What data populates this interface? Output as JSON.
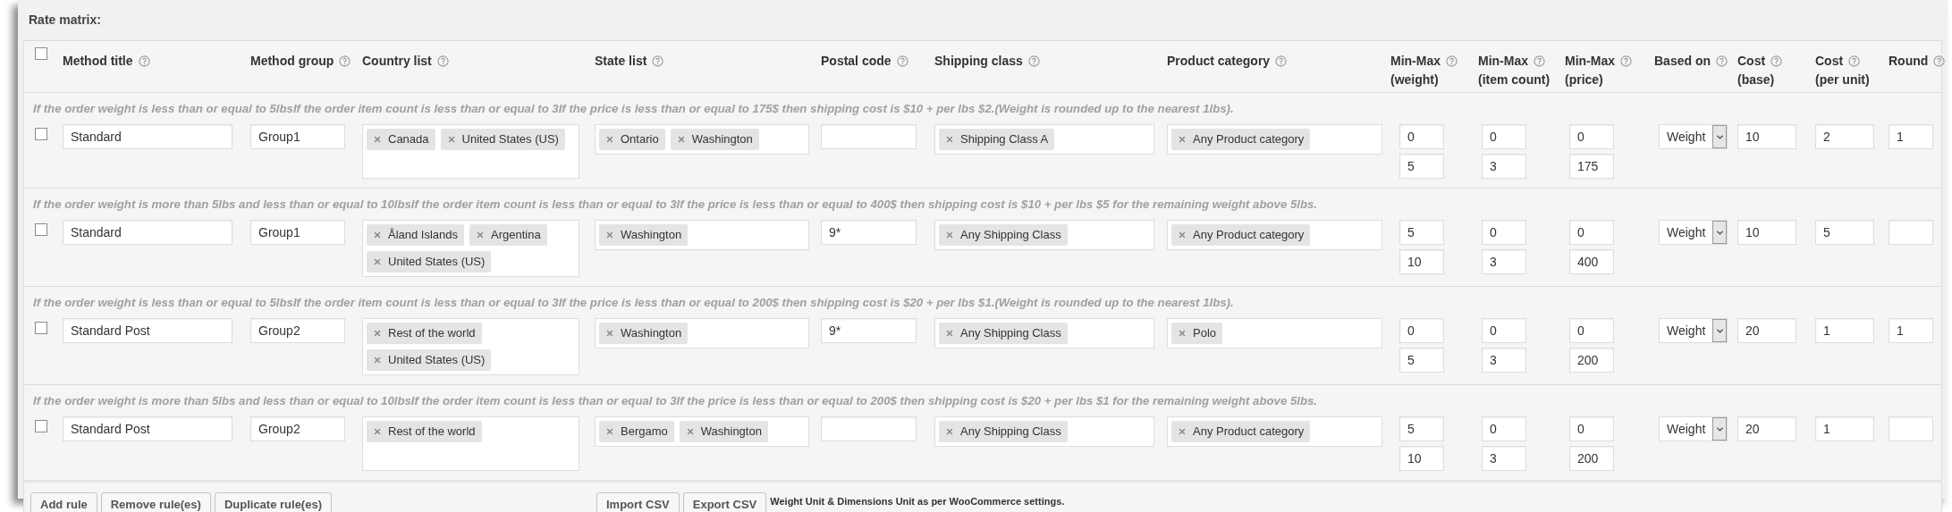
{
  "section_title": "Rate matrix:",
  "table": {
    "select_all": {
      "checked": false
    },
    "columns": [
      {
        "label": "Method title"
      },
      {
        "label": "Method group"
      },
      {
        "label": "Country list"
      },
      {
        "label": "State list"
      },
      {
        "label": "Postal code"
      },
      {
        "label": "Shipping class"
      },
      {
        "label": "Product category"
      },
      {
        "label": "Min-Max",
        "sublabel": "(weight)"
      },
      {
        "label": "Min-Max",
        "sublabel": "(item count)"
      },
      {
        "label": "Min-Max",
        "sublabel": "(price)"
      },
      {
        "label": "Based on"
      },
      {
        "label": "Cost",
        "sublabel": "(base)"
      },
      {
        "label": "Cost",
        "sublabel": "(per unit)"
      },
      {
        "label": "Round"
      }
    ],
    "rows": [
      {
        "description": "If the order weight is less than or equal to 5lbsIf the order item count is less than or equal to 3If the price is less than or equal to 175$ then shipping cost is $10 + per lbs $2.(Weight is rounded up to the nearest 1lbs).",
        "checked": false,
        "method_title": "Standard",
        "method_group": "Group1",
        "countries": [
          "Canada",
          "United States (US)"
        ],
        "states": [
          "Ontario",
          "Washington"
        ],
        "shipping_classes": [
          "Shipping Class A"
        ],
        "product_categories": [
          "Any Product category"
        ],
        "weight": {
          "min": "0",
          "max": "5"
        },
        "item_count": {
          "min": "0",
          "max": "3"
        },
        "price": {
          "min": "0",
          "max": "175"
        },
        "based_on": "Weight",
        "cost_base": "10",
        "cost_per_unit": "2",
        "round": "1"
      },
      {
        "description": "If the order weight is more than 5lbs and less than or equal to 10lbsIf the order item count is less than or equal to 3If the price is less than or equal to 400$ then shipping cost is $10 + per lbs $5 for the remaining weight above 5lbs.",
        "checked": false,
        "method_title": "Standard",
        "method_group": "Group1",
        "countries": [
          "Åland Islands",
          "Argentina",
          "United States (US)"
        ],
        "states": [
          "Washington"
        ],
        "postal_code": "9*",
        "shipping_classes": [
          "Any Shipping Class"
        ],
        "product_categories": [
          "Any Product category"
        ],
        "weight": {
          "min": "5",
          "max": "10"
        },
        "item_count": {
          "min": "0",
          "max": "3"
        },
        "price": {
          "min": "0",
          "max": "400"
        },
        "based_on": "Weight",
        "cost_base": "10",
        "cost_per_unit": "5"
      },
      {
        "description": "If the order weight is less than or equal to 5lbsIf the order item count is less than or equal to 3If the price is less than or equal to 200$ then shipping cost is $20 + per lbs $1.(Weight is rounded up to the nearest 1lbs).",
        "checked": false,
        "method_title": "Standard Post",
        "method_group": "Group2",
        "countries": [
          "Rest of the world",
          "United States (US)"
        ],
        "states": [
          "Washington"
        ],
        "postal_code": "9*",
        "shipping_classes": [
          "Any Shipping Class"
        ],
        "product_categories": [
          "Polo"
        ],
        "weight": {
          "min": "0",
          "max": "5"
        },
        "item_count": {
          "min": "0",
          "max": "3"
        },
        "price": {
          "min": "0",
          "max": "200"
        },
        "based_on": "Weight",
        "cost_base": "20",
        "cost_per_unit": "1",
        "round": "1"
      },
      {
        "description": "If the order weight is more than 5lbs and less than or equal to 10lbsIf the order item count is less than or equal to 3If the price is less than or equal to 200$ then shipping cost is $20 + per lbs $1 for the remaining weight above 5lbs.",
        "checked": false,
        "method_title": "Standard Post",
        "method_group": "Group2",
        "countries": [
          "Rest of the world"
        ],
        "states": [
          "Bergamo",
          "Washington"
        ],
        "shipping_classes": [
          "Any Shipping Class"
        ],
        "product_categories": [
          "Any Product category"
        ],
        "weight": {
          "min": "5",
          "max": "10"
        },
        "item_count": {
          "min": "0",
          "max": "3"
        },
        "price": {
          "min": "0",
          "max": "200"
        },
        "based_on": "Weight",
        "cost_base": "20",
        "cost_per_unit": "1"
      }
    ]
  },
  "footer": {
    "left_buttons": [
      "Add rule",
      "Remove rule(es)",
      "Duplicate rule(es)"
    ],
    "right_buttons": [
      "Import CSV",
      "Export CSV"
    ],
    "note": "Weight Unit & Dimensions Unit as per WooCommerce settings."
  }
}
